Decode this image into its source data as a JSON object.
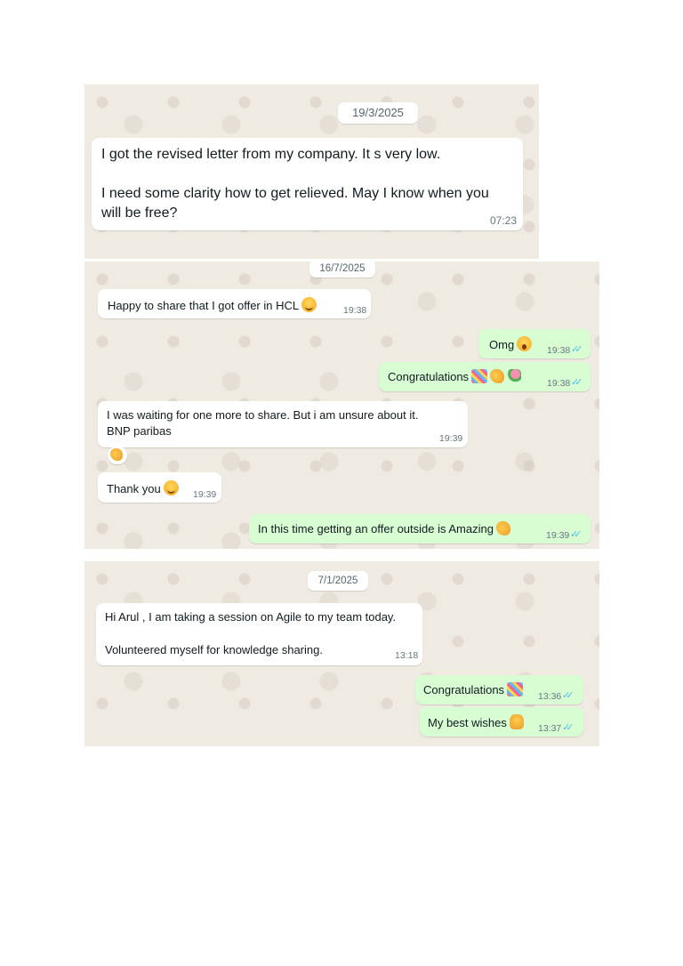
{
  "sections": [
    {
      "date": "19/3/2025",
      "messages": [
        {
          "direction": "incoming",
          "lines": [
            "I got the revised letter from my company. It s very low.",
            "",
            "I need some clarity how to get relieved. May I know when you",
            "will be free?"
          ],
          "time": "07:23"
        }
      ]
    },
    {
      "date": "16/7/2025",
      "messages": [
        {
          "direction": "incoming",
          "text": "Happy to share that I got offer in HCL",
          "emoji": [
            "smiling-face"
          ],
          "time": "19:38"
        },
        {
          "direction": "outgoing",
          "text": "Omg",
          "emoji": [
            "astonished-face"
          ],
          "time": "19:38",
          "status": "read"
        },
        {
          "direction": "outgoing",
          "text": "Congratulations",
          "emoji": [
            "confetti",
            "clapping-hands",
            "bouquet"
          ],
          "time": "19:38",
          "status": "read"
        },
        {
          "direction": "incoming",
          "lines": [
            "I was waiting for one more to share. But i am unsure about it.",
            "BNP paribas"
          ],
          "time": "19:39",
          "reaction": "clapping-hands"
        },
        {
          "direction": "incoming",
          "text": "Thank you",
          "emoji": [
            "smiling-face"
          ],
          "time": "19:39"
        },
        {
          "direction": "outgoing",
          "text": "In this time getting an offer outside is Amazing",
          "emoji": [
            "clapping-hands"
          ],
          "time": "19:39",
          "status": "read"
        }
      ]
    },
    {
      "date": "7/1/2025",
      "messages": [
        {
          "direction": "incoming",
          "lines": [
            "Hi Arul , I am taking a session on Agile to my team today.",
            "",
            "Volunteered myself for knowledge sharing."
          ],
          "time": "13:18"
        },
        {
          "direction": "outgoing",
          "text": "Congratulations",
          "emoji": [
            "confetti"
          ],
          "time": "13:36",
          "status": "read"
        },
        {
          "direction": "outgoing",
          "text": "My best wishes",
          "emoji": [
            "thumbs-up"
          ],
          "time": "13:37",
          "status": "read"
        }
      ]
    }
  ],
  "colors": {
    "chat_background": "#efeae2",
    "incoming_bubble": "#ffffff",
    "outgoing_bubble": "#d9fdd3",
    "read_tick": "#53bdeb",
    "timestamp": "#667781"
  },
  "icons": {
    "read_receipt": "double-check-icon"
  }
}
